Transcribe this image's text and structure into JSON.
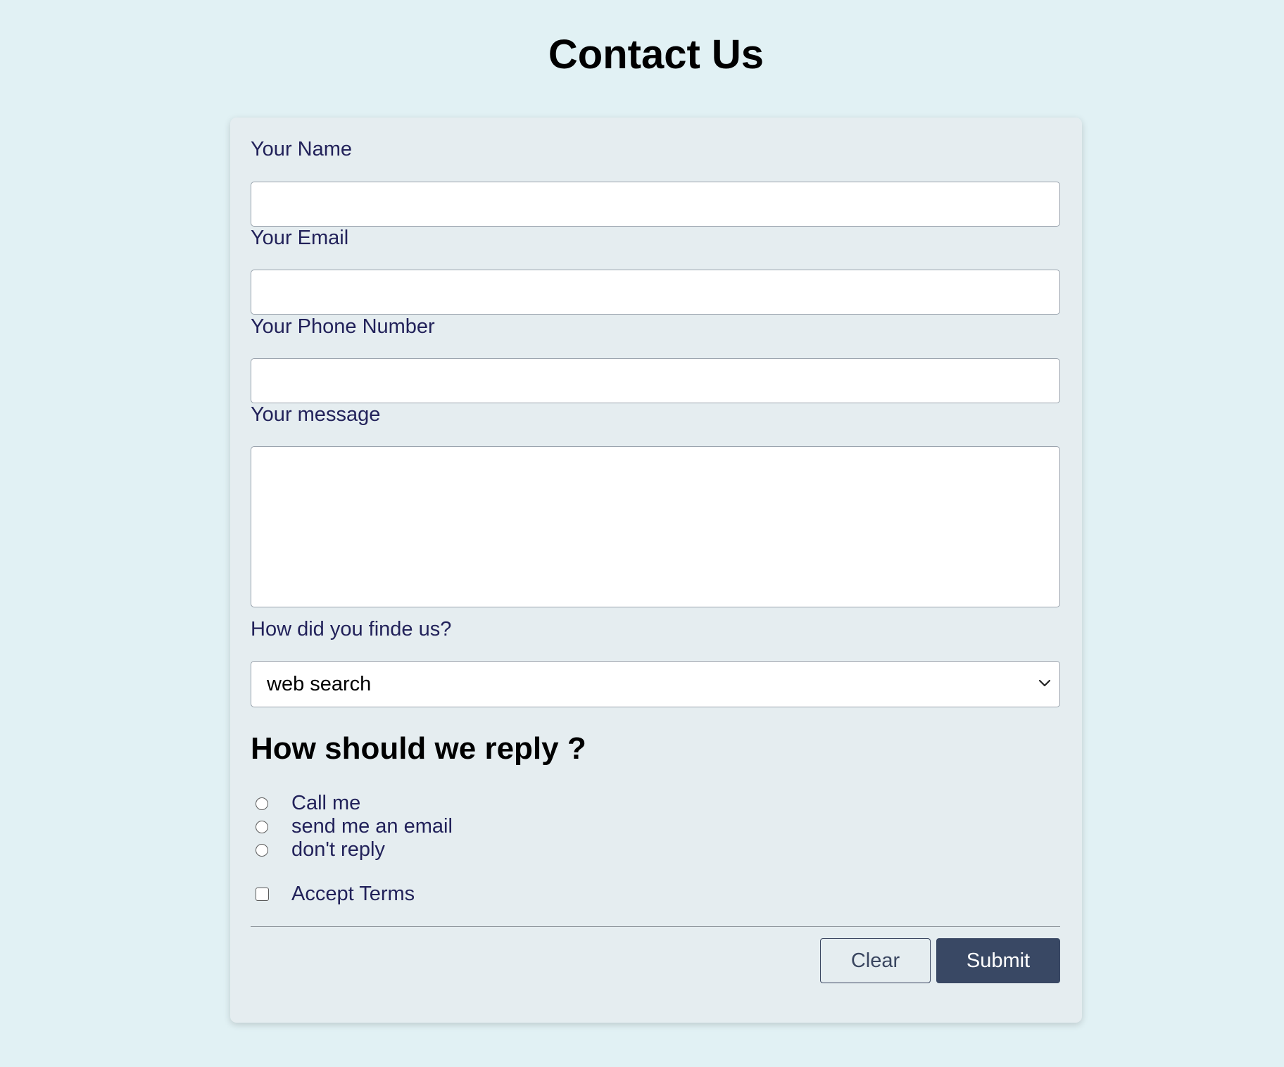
{
  "page": {
    "title": "Contact Us"
  },
  "form": {
    "name_label": "Your Name",
    "name_value": "",
    "email_label": "Your Email",
    "email_value": "",
    "phone_label": "Your Phone Number",
    "phone_value": "",
    "message_label": "Your message",
    "message_value": "",
    "source_label": "How did you finde us?",
    "source_selected": "web search",
    "reply_heading": "How should we reply ?",
    "reply_options": [
      {
        "label": "Call me",
        "selected": false
      },
      {
        "label": "send me an email",
        "selected": false
      },
      {
        "label": "don't reply",
        "selected": false
      }
    ],
    "terms_label": "Accept Terms",
    "terms_checked": false,
    "clear_label": "Clear",
    "submit_label": "Submit"
  },
  "colors": {
    "page_background": "#e1f1f4",
    "card_background": "#e5edf0",
    "label_text": "#22225a",
    "submit_background": "#394864",
    "submit_text": "#ffffff",
    "clear_border": "#3a4660"
  },
  "icons": {
    "select_arrow": "chevron-down-icon"
  }
}
